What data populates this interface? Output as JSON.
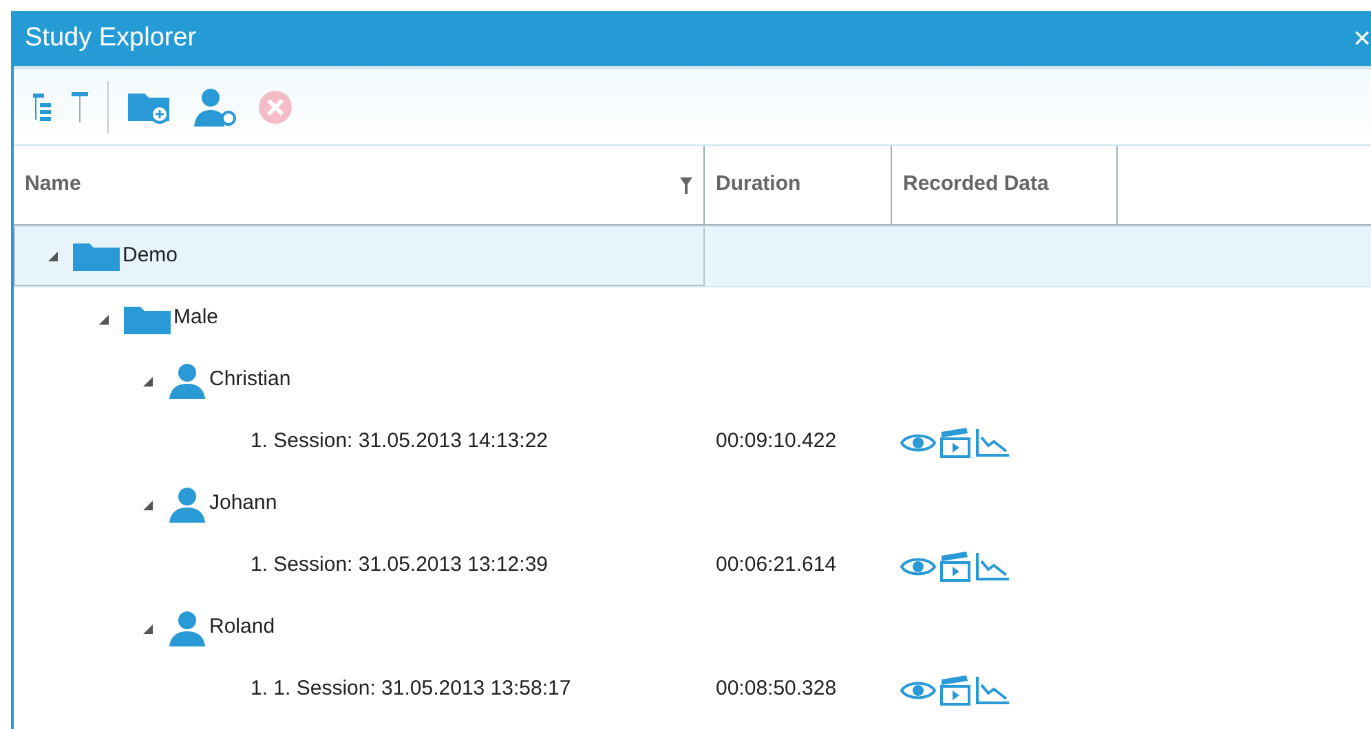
{
  "window": {
    "title": "Study Explorer",
    "close": "×"
  },
  "table": {
    "columns": [
      "Name",
      "Duration",
      "Recorded Data"
    ],
    "rows": [
      {
        "kind": "folder",
        "label": "Demo",
        "expanded": true,
        "selected": true,
        "children": [
          {
            "kind": "folder",
            "label": "Male",
            "expanded": true,
            "selected": false,
            "children": [
              {
                "kind": "subject",
                "label": "Christian",
                "expanded": true,
                "selected": false,
                "children": [
                  {
                    "kind": "session",
                    "label": "1. Session: 31.05.2013 14:13:22",
                    "duration": "00:09:10.422",
                    "selected": false
                  }
                ]
              },
              {
                "kind": "subject",
                "label": "Johann",
                "expanded": true,
                "selected": false,
                "children": [
                  {
                    "kind": "session",
                    "label": "1. Session: 31.05.2013 13:12:39",
                    "duration": "00:06:21.614",
                    "selected": false
                  }
                ]
              },
              {
                "kind": "subject",
                "label": "Roland",
                "expanded": true,
                "selected": false,
                "children": [
                  {
                    "kind": "session",
                    "label": "1. 1. Session: 31.05.2013 13:58:17",
                    "duration": "00:08:50.328",
                    "selected": false
                  }
                ]
              }
            ]
          }
        ]
      }
    ]
  }
}
